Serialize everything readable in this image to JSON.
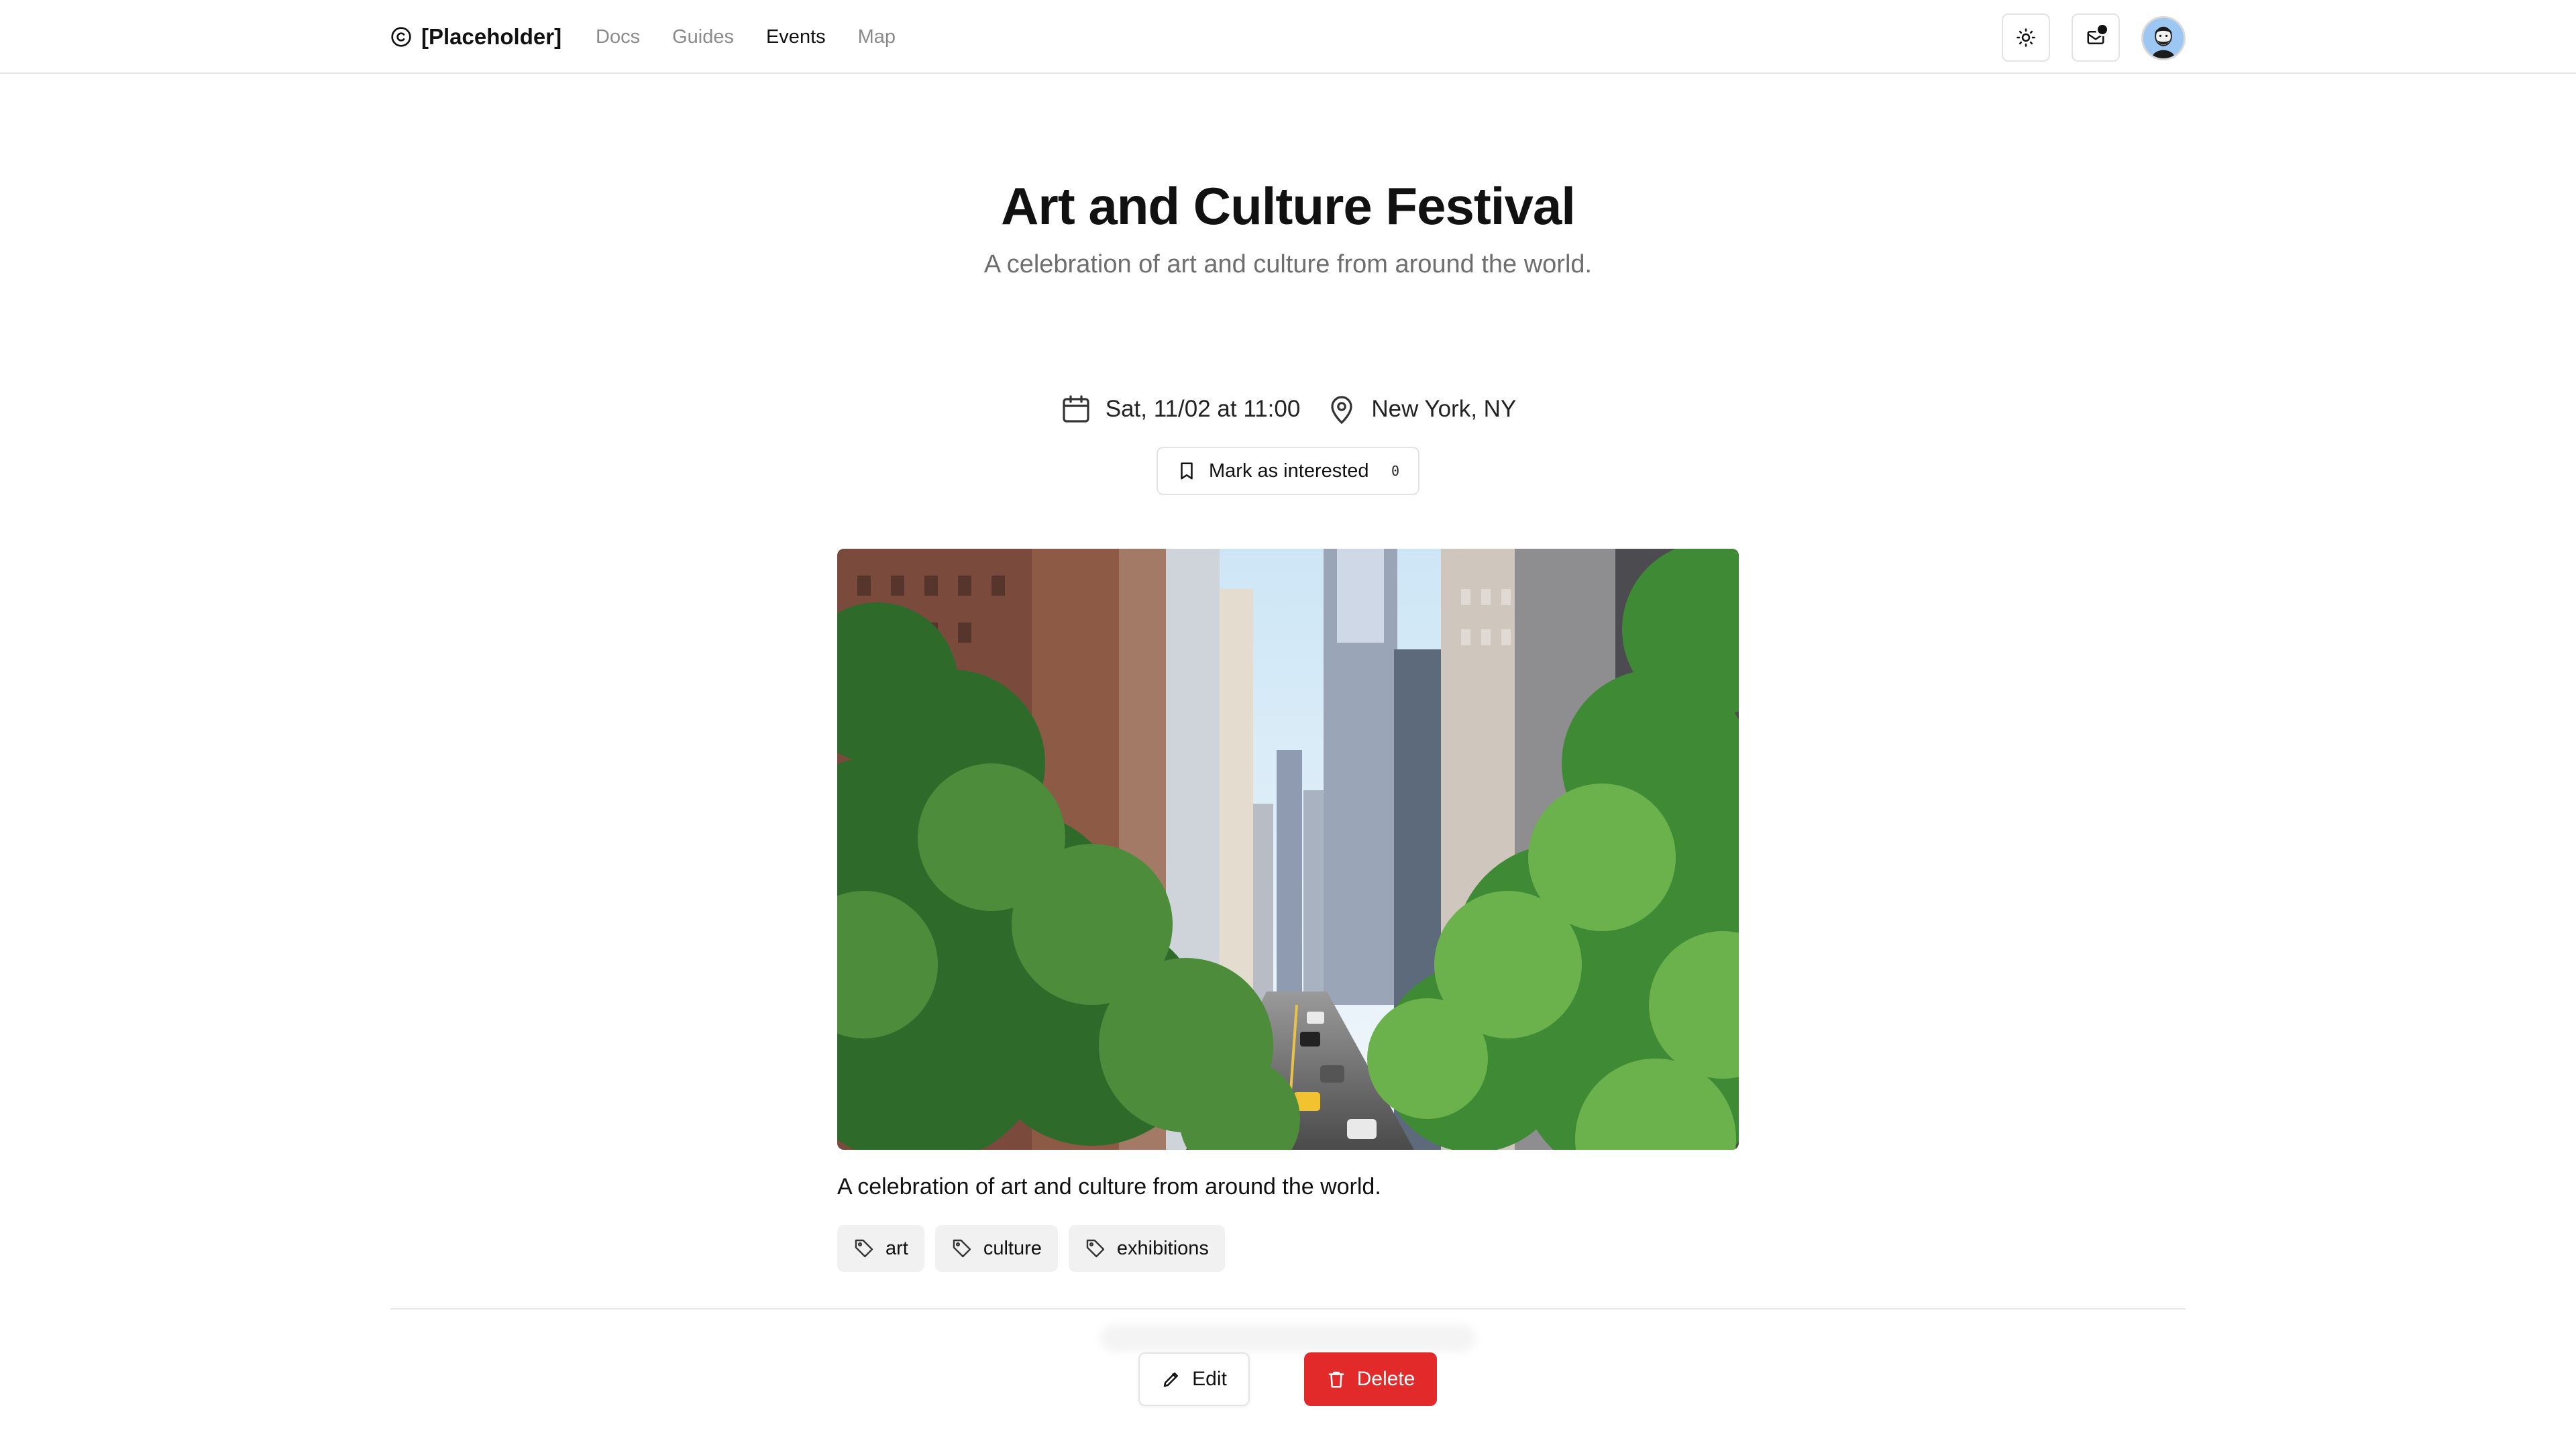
{
  "header": {
    "brand": "[Placeholder]",
    "nav": [
      {
        "label": "Docs",
        "active": false
      },
      {
        "label": "Guides",
        "active": false
      },
      {
        "label": "Events",
        "active": true
      },
      {
        "label": "Map",
        "active": false
      }
    ],
    "icons": {
      "brand": "copyright-icon",
      "theme_toggle": "sun-icon",
      "inbox": "inbox-icon",
      "avatar": "user-avatar"
    }
  },
  "event": {
    "title": "Art and Culture Festival",
    "subtitle": "A celebration of art and culture from around the world.",
    "date": "Sat, 11/02 at 11:00",
    "location": "New York, NY",
    "interested_label": "Mark as interested",
    "interested_count": "0",
    "image_alt": "City street lined with trees and skyscrapers",
    "description": "A celebration of art and culture from around the world.",
    "tags": [
      "art",
      "culture",
      "exhibitions"
    ]
  },
  "actions": {
    "edit_label": "Edit",
    "delete_label": "Delete"
  },
  "colors": {
    "accent_danger": "#e22a2a",
    "text_primary": "#111111",
    "text_muted": "#6e6e6e",
    "nav_inactive": "#8a8a8a",
    "border": "#e3e3e3",
    "tag_bg": "#f1f1f1"
  }
}
